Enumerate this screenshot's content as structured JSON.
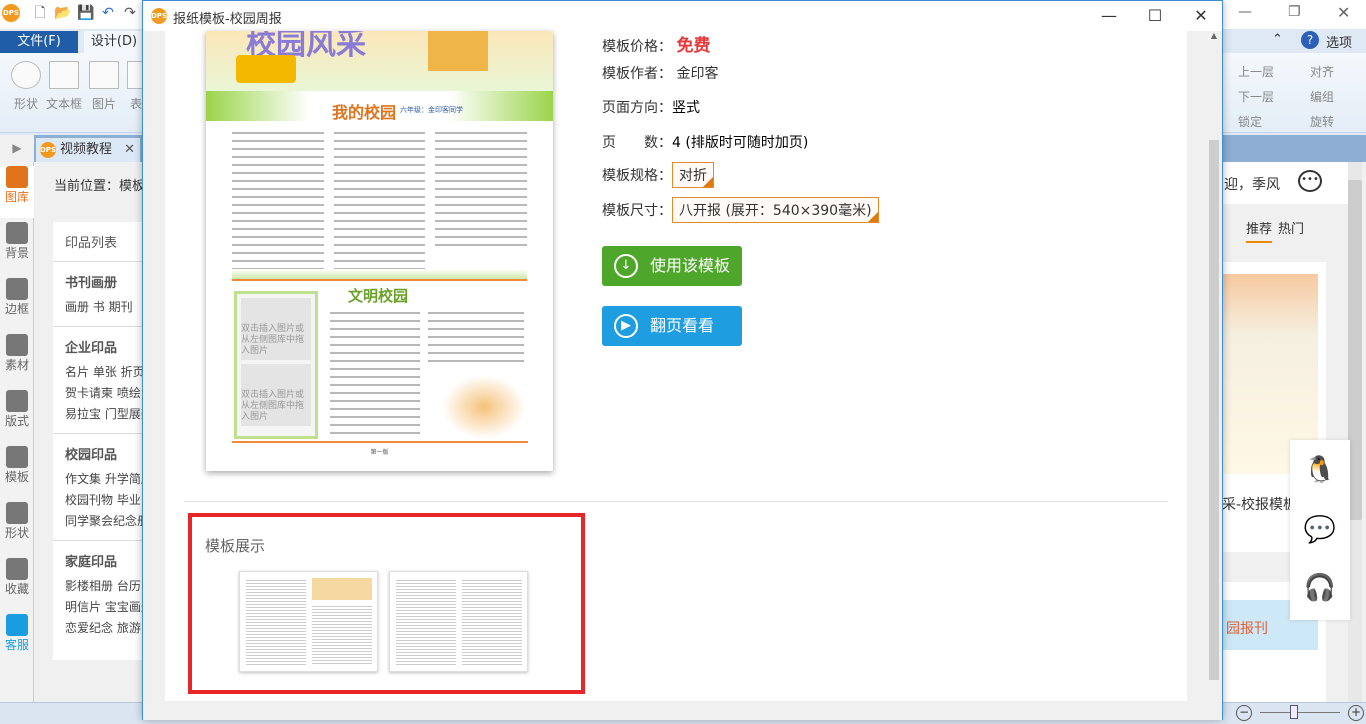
{
  "app": {
    "logo": "DPS",
    "quick_access_icons": [
      "new-file-icon",
      "open-folder-icon",
      "save-icon",
      "undo-icon",
      "redo-icon"
    ],
    "ribbon_tabs": [
      {
        "label": "文件(F)",
        "active": false
      },
      {
        "label": "设计(D)",
        "active": true
      }
    ],
    "ribbon_buttons": [
      "形状",
      "文本框",
      "图片",
      "表格"
    ],
    "ribbon_right": {
      "options": "选项",
      "items": [
        "上一层",
        "对齐",
        "下一层",
        "编组",
        "锁定",
        "旋转"
      ]
    },
    "doc_tab": "视频教程",
    "breadcrumb": "当前位置：模板",
    "left_tools": [
      "图库",
      "背景",
      "边框",
      "素材",
      "版式",
      "模板",
      "形状",
      "收藏",
      "客服"
    ],
    "print_list": {
      "title": "印品列表",
      "sections": [
        {
          "title": "书刊画册",
          "rows": [
            "画册  书  期刊"
          ]
        },
        {
          "title": "企业印品",
          "rows": [
            "名片  单张  折页",
            "贺卡请柬  喷绘",
            "易拉宝  门型展架"
          ]
        },
        {
          "title": "校园印品",
          "rows": [
            "作文集  升学简历",
            "校园刊物  毕业",
            "同学聚会纪念册"
          ]
        },
        {
          "title": "家庭印品",
          "rows": [
            "影楼相册  台历",
            "明信片  宝宝画册",
            "恋爱纪念  旅游"
          ]
        }
      ]
    },
    "right_panel": {
      "welcome": "迎，季风",
      "tabs": [
        {
          "label": "推荐",
          "active": true
        },
        {
          "label": "热门",
          "active": false
        }
      ],
      "card_title": "采-校报模板",
      "card2_title": "园报刊",
      "float_icons": [
        "qq-icon",
        "wechat-icon",
        "headset-icon"
      ]
    },
    "accent": "#f08a00"
  },
  "dialog": {
    "title": "报纸模板-校园周报",
    "preview": {
      "banner_title": "校园风采",
      "section1_title": "我的校园",
      "section1_byline": "六年级：金印客同学",
      "section2_title": "文明校园",
      "placeholder": "双击插入图片或从左侧图库中拖入图片",
      "page_label": "第一版"
    },
    "info": {
      "price_label": "模板价格：",
      "price_value": "免费",
      "author_label": "模板作者：",
      "author_value": "金印客",
      "orientation_label": "页面方向：",
      "orientation_value": "竖式",
      "pages_label": "页　　数：",
      "pages_value": "4 (排版时可随时加页)",
      "spec_label": "模板规格：",
      "spec_value": "对折",
      "size_label": "模板尺寸：",
      "size_value": "八开报 (展开：540×390毫米)"
    },
    "use_button": "使用该模板",
    "flip_button": "翻页看看",
    "showcase_title": "模板展示",
    "colors": {
      "price": "#e8393b",
      "use": "#4ea72a",
      "flip": "#1e9ee0",
      "highlight": "#e8262a"
    }
  }
}
